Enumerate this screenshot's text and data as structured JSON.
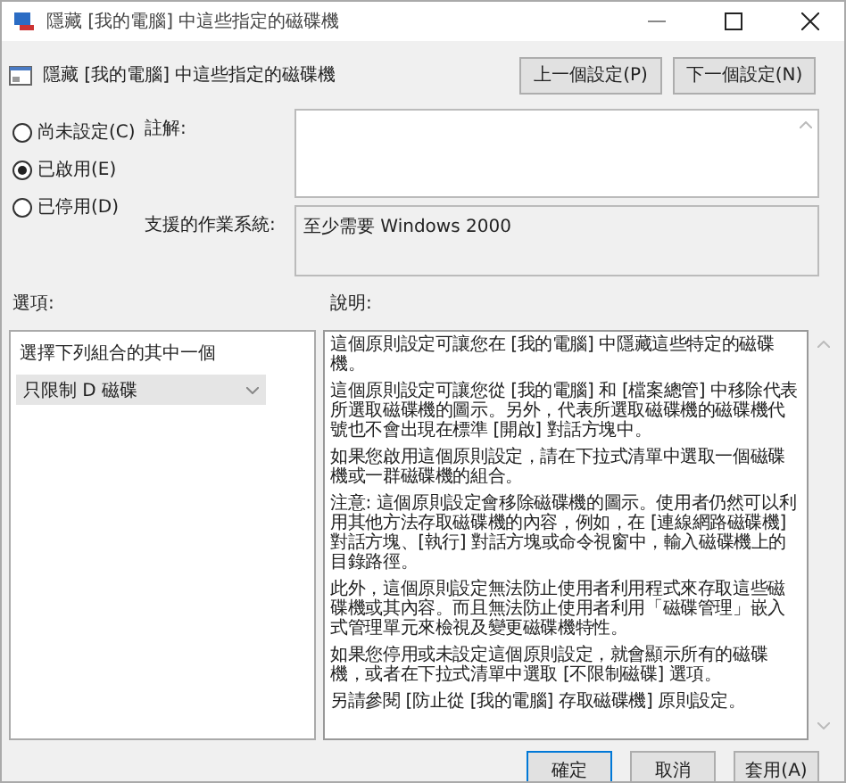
{
  "window": {
    "title": "隱藏 [我的電腦] 中這些指定的磁碟機"
  },
  "header": {
    "title": "隱藏 [我的電腦] 中這些指定的磁碟機",
    "buttons": [
      {
        "label": "上一個設定(P)"
      },
      {
        "label": "下一個設定(N)"
      }
    ]
  },
  "state_options": [
    {
      "label": "尚未設定(C)",
      "selected": false
    },
    {
      "label": "已啟用(E)",
      "selected": true
    },
    {
      "label": "已停用(D)",
      "selected": false
    }
  ],
  "comment": {
    "label": "註解:"
  },
  "supported_on": {
    "label": "支援的作業系統:",
    "value": "至少需要 Windows 2000"
  },
  "options": {
    "label": "選項:",
    "prompt": "選擇下列組合的其中一個",
    "dropdown": {
      "value": "只限制 D 磁碟"
    }
  },
  "help": {
    "label": "說明:",
    "paragraphs": [
      "這個原則設定可讓您在 [我的電腦] 中隱藏這些特定的磁碟機。",
      "這個原則設定可讓您從 [我的電腦] 和 [檔案總管] 中移除代表所選取磁碟機的圖示。另外，代表所選取磁碟機的磁碟機代號也不會出現在標準 [開啟] 對話方塊中。",
      "如果您啟用這個原則設定，請在下拉式清單中選取一個磁碟機或一群磁碟機的組合。",
      "注意: 這個原則設定會移除磁碟機的圖示。使用者仍然可以利用其他方法存取磁碟機的內容，例如，在 [連線網路磁碟機] 對話方塊、[執行] 對話方塊或命令視窗中，輸入磁碟機上的目錄路徑。",
      "此外，這個原則設定無法防止使用者利用程式來存取這些磁碟機或其內容。而且無法防止使用者利用「磁碟管理」嵌入式管理單元來檢視及變更磁碟機特性。",
      "如果您停用或未設定這個原則設定，就會顯示所有的磁碟機，或者在下拉式清單中選取 [不限制磁碟] 選項。",
      "另請參閱 [防止從 [我的電腦] 存取磁碟機] 原則設定。"
    ]
  },
  "footer_buttons": [
    {
      "label": "確定",
      "kind": "default"
    },
    {
      "label": "取消",
      "kind": "normal"
    },
    {
      "label": "套用(A)",
      "kind": "normal"
    }
  ]
}
